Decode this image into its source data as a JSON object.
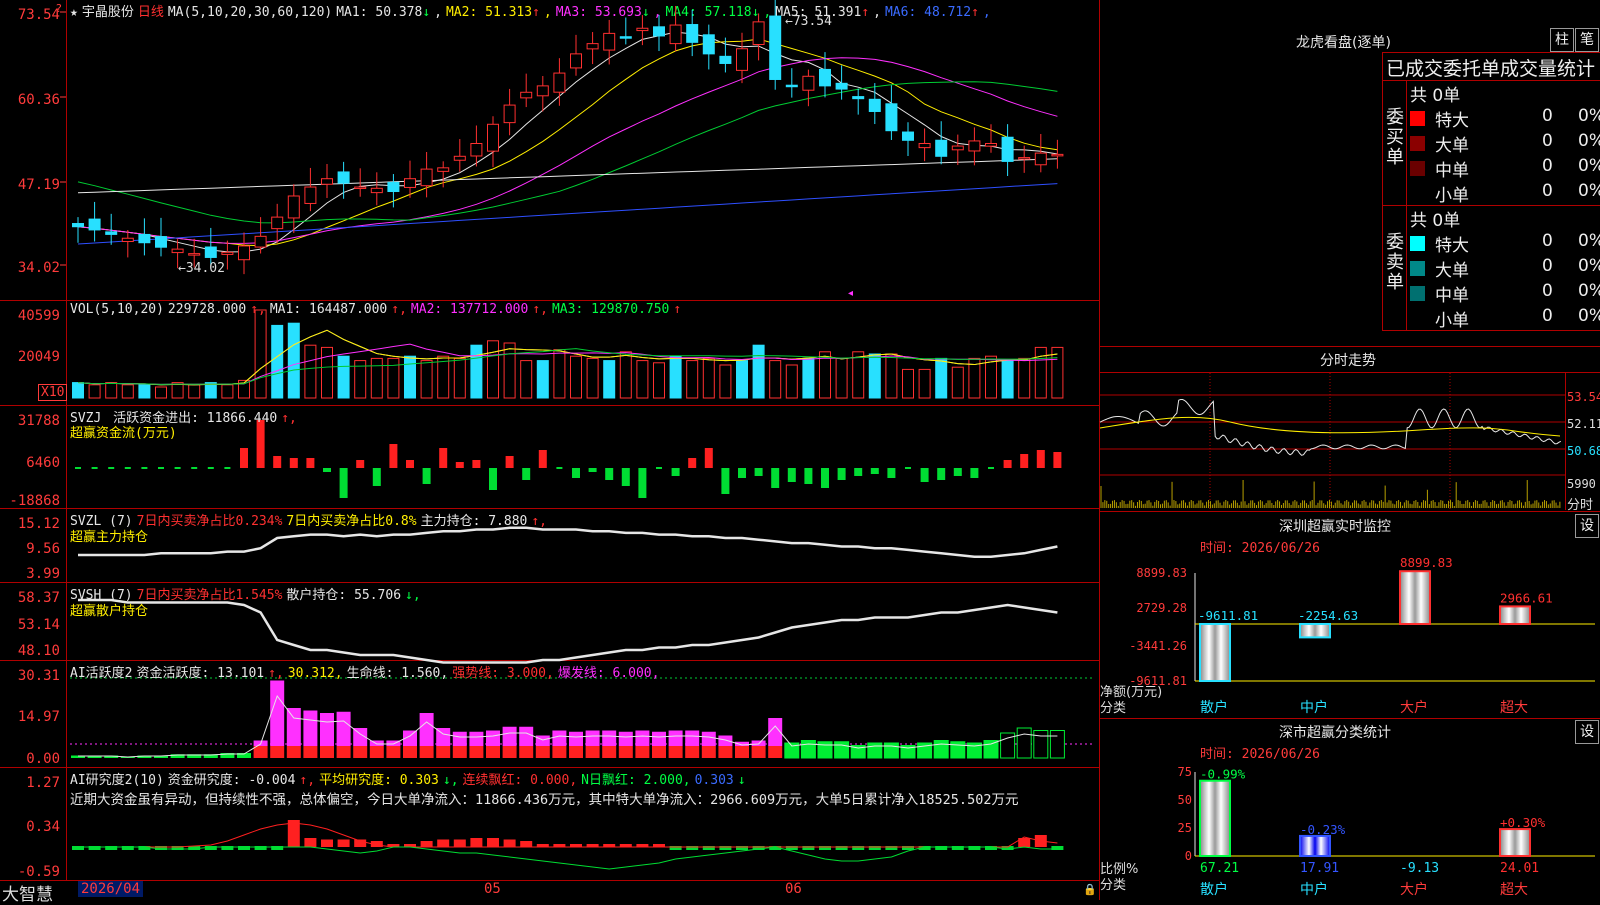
{
  "stock": {
    "name": "宇晶股份",
    "period": "日线",
    "ma_params": "MA(5,10,20,30,60,120)"
  },
  "main": {
    "ma": [
      {
        "label": "MA1:",
        "value": "50.378",
        "arrow": "↓",
        "color": "#e6e6e6"
      },
      {
        "label": "MA2:",
        "value": "51.313",
        "arrow": "↑",
        "color": "#ffee00"
      },
      {
        "label": "MA3:",
        "value": "53.693",
        "arrow": "↓",
        "color": "#ff30ff"
      },
      {
        "label": "MA4:",
        "value": "57.118",
        "arrow": "↓",
        "color": "#00ff44"
      },
      {
        "label": "MA5:",
        "value": "51.391",
        "arrow": "↑",
        "color": "#e6e6e6"
      },
      {
        "label": "MA6:",
        "value": "48.712",
        "arrow": "↑",
        "color": "#3a6bff"
      }
    ],
    "y_labels": [
      "73.54",
      "60.36",
      "47.19",
      "34.02"
    ],
    "high_marker": "73.54",
    "low_marker": "34.02"
  },
  "vol": {
    "title": "VOL(5,10,20)",
    "value": "229728.000",
    "ma1": "MA1: 164487.000",
    "ma2": "MA2: 137712.000",
    "ma3": "MA3: 129870.750",
    "y_labels": [
      "40599",
      "20049"
    ],
    "unit": "X10"
  },
  "svzj": {
    "title": "SVZJ",
    "label": "活跃资金进出: 11866.440",
    "sub": "超赢资金流(万元)",
    "y_labels": [
      "31788",
      "6460",
      "-18868"
    ]
  },
  "svzl": {
    "title": "SVZL (7)",
    "a": "7日内买卖净占比0.234%",
    "b": "7日内买卖净占比0.8%",
    "c": "主力持仓: 7.880",
    "sub": "超赢主力持仓",
    "y_labels": [
      "15.12",
      "9.56",
      "3.99"
    ]
  },
  "svsh": {
    "title": "SVSH (7)",
    "a": "7日内买卖净占比1.545%",
    "c": "散户持仓: 55.706",
    "sub": "超赢散户持仓",
    "y_labels": [
      "58.37",
      "53.14",
      "48.10"
    ]
  },
  "ai_active": {
    "title": "AI活跃度2",
    "a": "资金活跃度: 13.101",
    "b": "30.312,",
    "c": "生命线: 1.560,",
    "d": "强势线: 3.000,",
    "e": "爆发线: 6.000,",
    "y_labels": [
      "30.31",
      "14.97",
      "0.00"
    ]
  },
  "ai_research": {
    "title": "AI研究度2(10)",
    "a": "资金研究度: -0.004",
    "b": "平均研究度: 0.303",
    "c": "连续飘红: 0.000,",
    "d": "N日飘红: 2.000,",
    "e": "0.303",
    "y_labels": [
      "1.27",
      "0.34",
      "-0.59"
    ],
    "note": "近期大资金虽有异动，但持续性不强，总体偏空，今日大单净流入：11866.436万元，其中特大单净流入：2966.609万元，大单5日累计净入18525.502万元"
  },
  "x_axis": {
    "brand": "大智慧",
    "start": "2026/04",
    "m2": "05",
    "m3": "06"
  },
  "right": {
    "lhb": {
      "title": "龙虎看盘(逐单)",
      "btn1": "柱",
      "btn2": "笔",
      "subtitle": "已成交委托单成交量统计",
      "buy_label": "委买单",
      "buy_total": "共 0单",
      "buy_rows": [
        {
          "name": "特大",
          "v": "0",
          "p": "0%",
          "color": "#ff0000"
        },
        {
          "name": "大单",
          "v": "0",
          "p": "0%",
          "color": "#8b0000"
        },
        {
          "name": "中单",
          "v": "0",
          "p": "0%",
          "color": "#6a0000"
        },
        {
          "name": "小单",
          "v": "0",
          "p": "0%",
          "color": "#000000"
        }
      ],
      "sell_label": "委卖单",
      "sell_total": "共 0单",
      "sell_rows": [
        {
          "name": "特大",
          "v": "0",
          "p": "0%",
          "color": "#00ffff"
        },
        {
          "name": "大单",
          "v": "0",
          "p": "0%",
          "color": "#008888"
        },
        {
          "name": "中单",
          "v": "0",
          "p": "0%",
          "color": "#007070"
        },
        {
          "name": "小单",
          "v": "0",
          "p": "0%",
          "color": "#000000"
        }
      ]
    },
    "fenshi": {
      "title": "分时走势",
      "y": [
        "53.54",
        "52.11",
        "50.68"
      ],
      "vol": "5990",
      "unit": "分时"
    },
    "monitor": {
      "title": "深圳超赢实时监控",
      "btn": "设",
      "time": "时间: 2026/06/26",
      "y": [
        "8899.83",
        "2729.28",
        "-3441.26",
        "-9611.81"
      ],
      "bars": [
        {
          "cat": "散户",
          "value": "-9611.81"
        },
        {
          "cat": "中户",
          "value": "-2254.63"
        },
        {
          "cat": "大户",
          "value": "8899.83"
        },
        {
          "cat": "超大",
          "value": "2966.61"
        }
      ],
      "ylabel1": "净额(万元)",
      "ylabel2": "分类"
    },
    "classify": {
      "title": "深市超赢分类统计",
      "btn": "设",
      "time": "时间: 2026/06/26",
      "y": [
        "75",
        "50",
        "25",
        "0"
      ],
      "bars": [
        {
          "cat": "散户",
          "pct": "-0.99%",
          "v": "67.21"
        },
        {
          "cat": "中户",
          "pct": "-0.23%",
          "v": "17.91"
        },
        {
          "cat": "大户",
          "pct": "",
          "v": "-9.13"
        },
        {
          "cat": "超大",
          "pct": "+0.30%",
          "v": "24.01"
        }
      ],
      "ylabel1": "比例%",
      "ylabel2": "分类"
    }
  }
}
